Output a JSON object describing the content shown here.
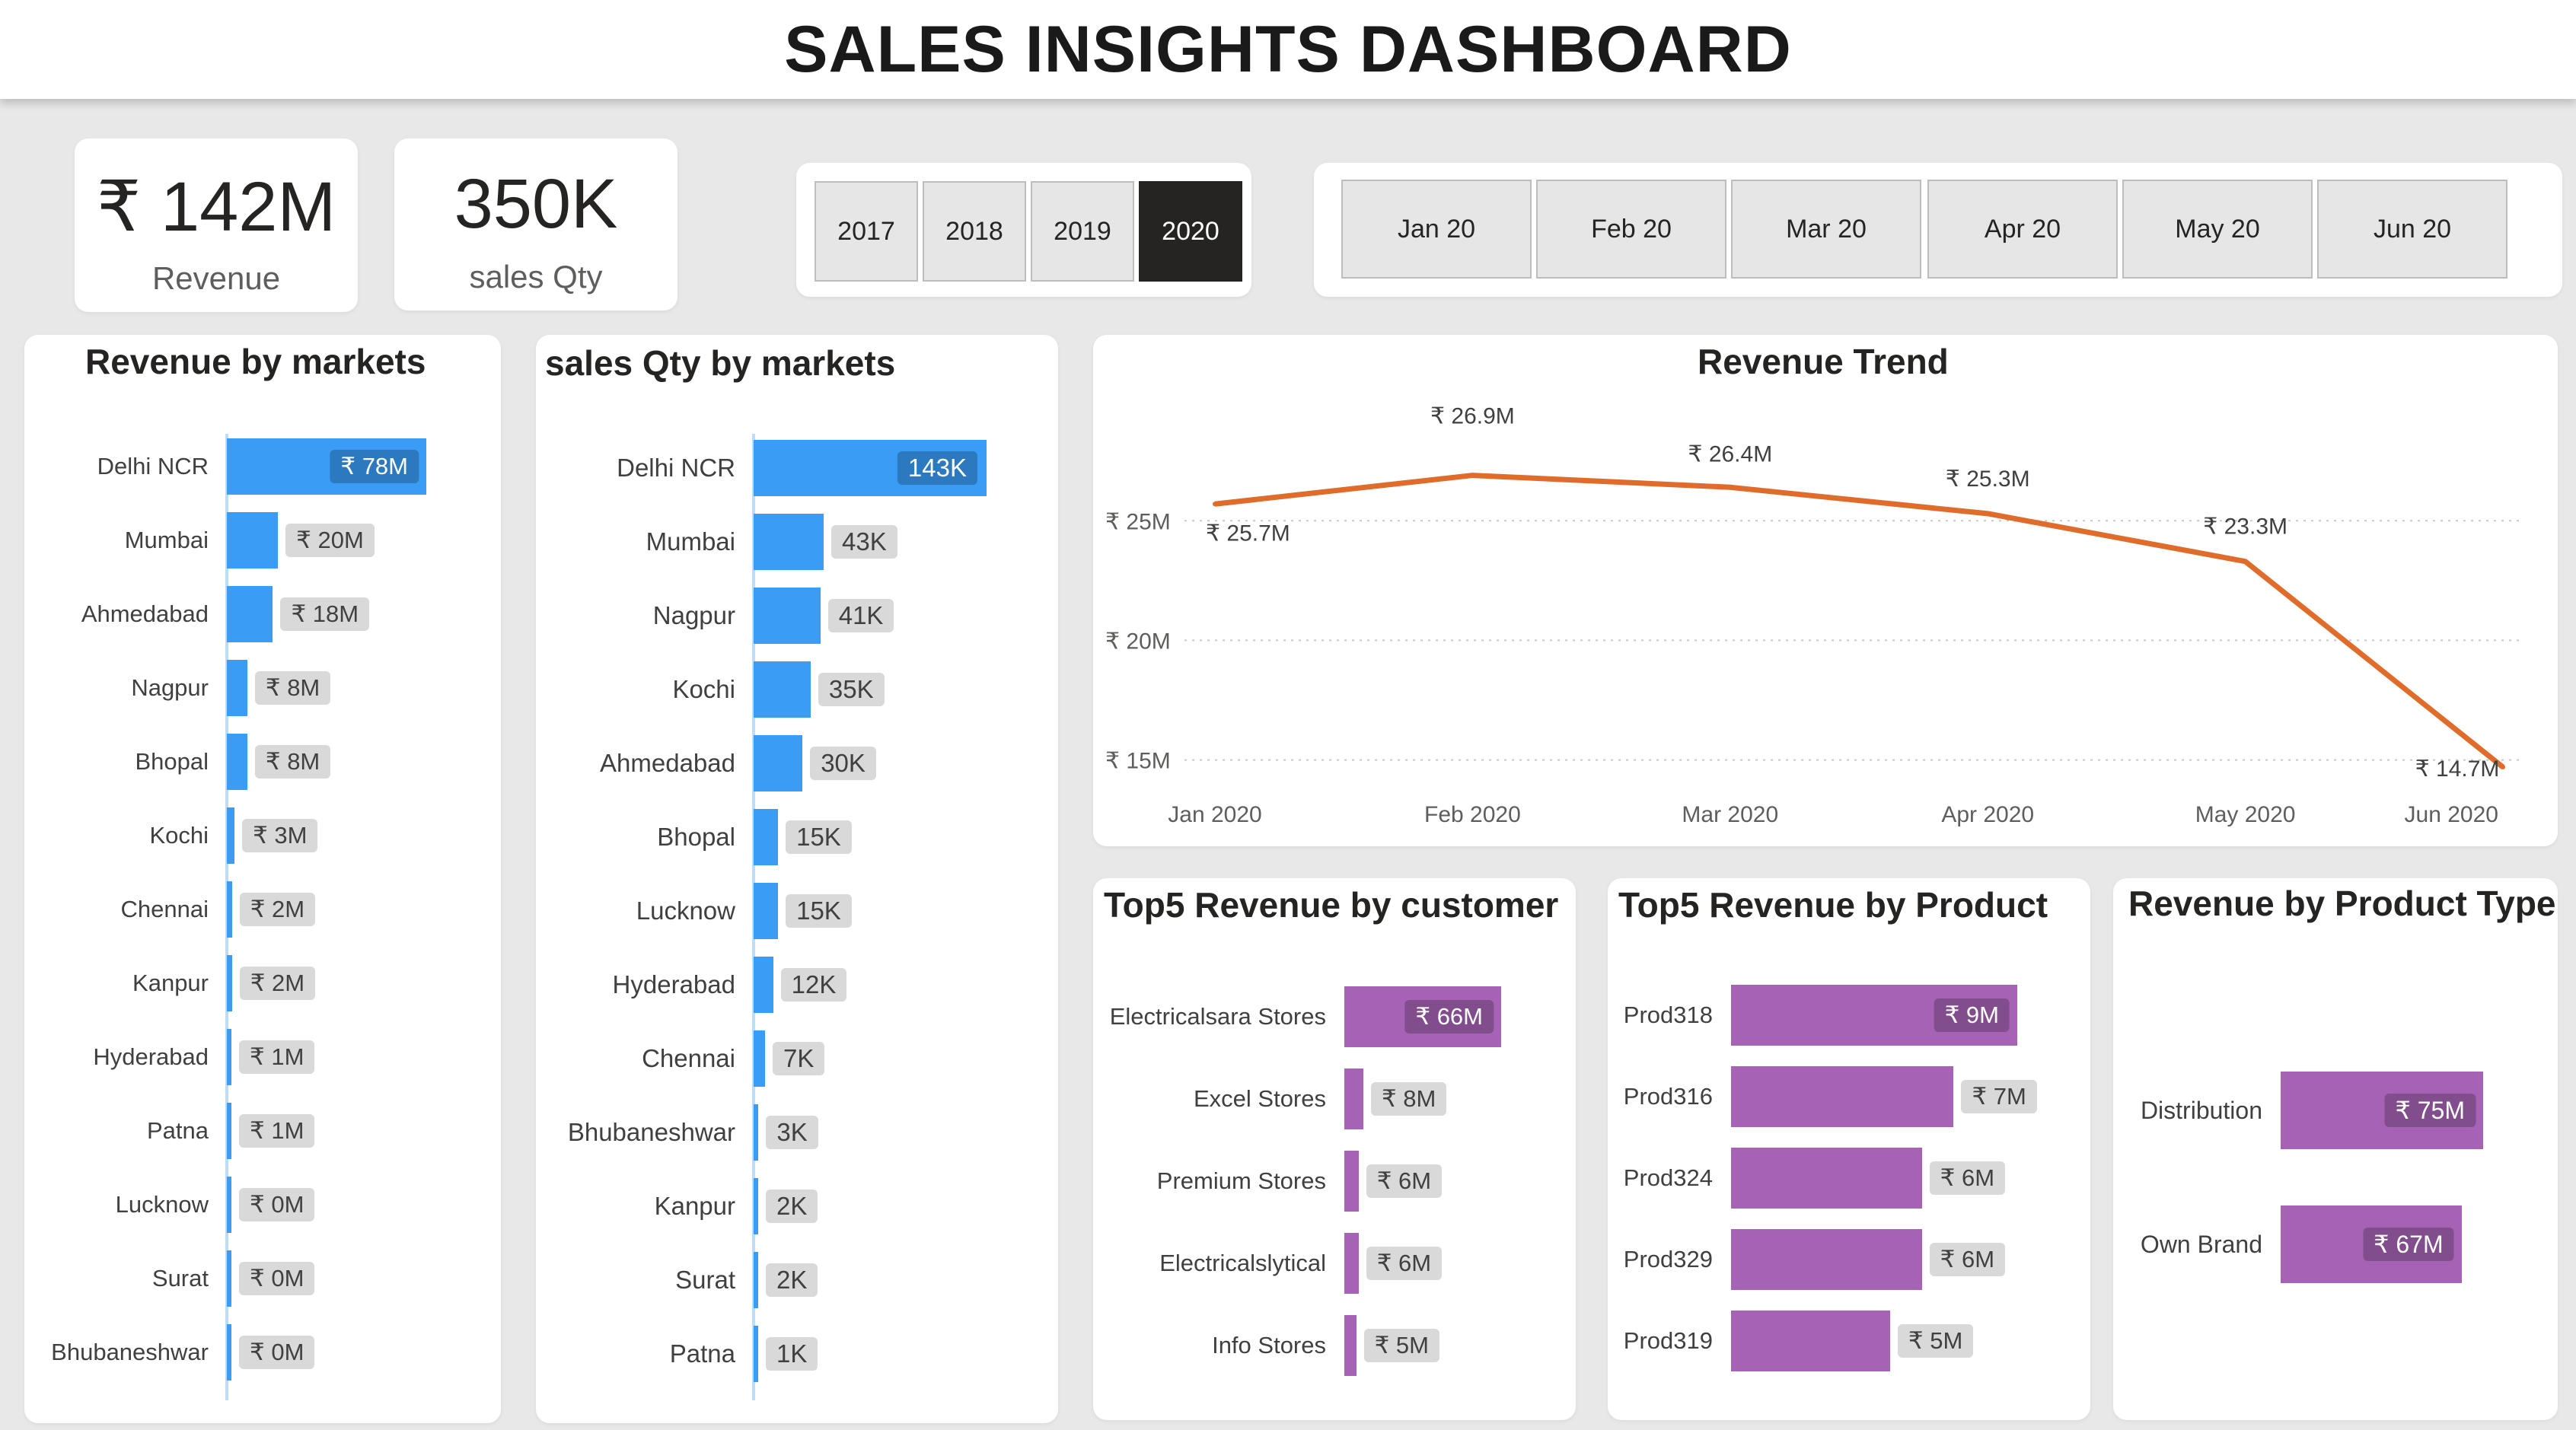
{
  "header": {
    "title": "SALES INSIGHTS DASHBOARD"
  },
  "kpis": [
    {
      "value": "₹ 142M",
      "label": "Revenue"
    },
    {
      "value": "350K",
      "label": "sales Qty"
    }
  ],
  "year_slicer": {
    "options": [
      "2017",
      "2018",
      "2019",
      "2020"
    ],
    "selected": "2020"
  },
  "month_slicer": {
    "options": [
      "Jan 20",
      "Feb 20",
      "Mar 20",
      "Apr 20",
      "May 20",
      "Jun 20"
    ]
  },
  "colors": {
    "blue": "#3a9cf5",
    "orange": "#e06c2c",
    "purple": "#a663b5",
    "label_bg": "#d9d9d9"
  },
  "chart_data": [
    {
      "id": "revenue_by_markets",
      "type": "bar",
      "orientation": "horizontal",
      "title": "Revenue by markets",
      "categories": [
        "Delhi NCR",
        "Mumbai",
        "Ahmedabad",
        "Nagpur",
        "Bhopal",
        "Kochi",
        "Chennai",
        "Kanpur",
        "Hyderabad",
        "Patna",
        "Lucknow",
        "Surat",
        "Bhubaneshwar"
      ],
      "values": [
        78,
        20,
        18,
        8,
        8,
        3,
        2,
        2,
        1,
        1,
        0,
        0,
        0
      ],
      "labels": [
        "₹ 78M",
        "₹ 20M",
        "₹ 18M",
        "₹ 8M",
        "₹ 8M",
        "₹ 3M",
        "₹ 2M",
        "₹ 2M",
        "₹ 1M",
        "₹ 1M",
        "₹ 0M",
        "₹ 0M",
        "₹ 0M"
      ],
      "unit": "₹ M",
      "color": "#3a9cf5"
    },
    {
      "id": "sales_qty_by_markets",
      "type": "bar",
      "orientation": "horizontal",
      "title": "sales Qty by markets",
      "categories": [
        "Delhi NCR",
        "Mumbai",
        "Nagpur",
        "Kochi",
        "Ahmedabad",
        "Bhopal",
        "Lucknow",
        "Hyderabad",
        "Chennai",
        "Bhubaneshwar",
        "Kanpur",
        "Surat",
        "Patna"
      ],
      "values": [
        143,
        43,
        41,
        35,
        30,
        15,
        15,
        12,
        7,
        3,
        2,
        2,
        1
      ],
      "labels": [
        "143K",
        "43K",
        "41K",
        "35K",
        "30K",
        "15K",
        "15K",
        "12K",
        "7K",
        "3K",
        "2K",
        "2K",
        "1K"
      ],
      "unit": "K",
      "color": "#3a9cf5"
    },
    {
      "id": "revenue_trend",
      "type": "line",
      "title": "Revenue Trend",
      "x": [
        "Jan 2020",
        "Feb 2020",
        "Mar 2020",
        "Apr 2020",
        "May 2020",
        "Jun 2020"
      ],
      "values": [
        25.7,
        26.9,
        26.4,
        25.3,
        23.3,
        14.7
      ],
      "labels": [
        "₹ 25.7M",
        "₹ 26.9M",
        "₹ 26.4M",
        "₹ 25.3M",
        "₹ 23.3M",
        "₹ 14.7M"
      ],
      "y_ticks": [
        15,
        20,
        25
      ],
      "y_tick_labels": [
        "₹ 15M",
        "₹ 20M",
        "₹ 25M"
      ],
      "ylim": [
        14,
        28
      ],
      "grid": true,
      "color": "#e06c2c"
    },
    {
      "id": "top5_revenue_by_customer",
      "type": "bar",
      "orientation": "horizontal",
      "title": "Top5 Revenue by customer",
      "categories": [
        "Electricalsara Stores",
        "Excel Stores",
        "Premium Stores",
        "Electricalslytical",
        "Info Stores"
      ],
      "values": [
        66,
        8,
        6,
        6,
        5
      ],
      "labels": [
        "₹ 66M",
        "₹ 8M",
        "₹ 6M",
        "₹ 6M",
        "₹ 5M"
      ],
      "unit": "₹ M",
      "color": "#a663b5"
    },
    {
      "id": "top5_revenue_by_product",
      "type": "bar",
      "orientation": "horizontal",
      "title": "Top5 Revenue by Product",
      "categories": [
        "Prod318",
        "Prod316",
        "Prod324",
        "Prod329",
        "Prod319"
      ],
      "values": [
        9,
        7,
        6,
        6,
        5
      ],
      "labels": [
        "₹ 9M",
        "₹ 7M",
        "₹ 6M",
        "₹ 6M",
        "₹ 5M"
      ],
      "unit": "₹ M",
      "color": "#a663b5"
    },
    {
      "id": "revenue_by_product_type",
      "type": "bar",
      "orientation": "horizontal",
      "title": "Revenue by Product Type",
      "categories": [
        "Distribution",
        "Own Brand"
      ],
      "values": [
        75,
        67
      ],
      "labels": [
        "₹ 75M",
        "₹ 67M"
      ],
      "unit": "₹ M",
      "color": "#a663b5"
    }
  ]
}
